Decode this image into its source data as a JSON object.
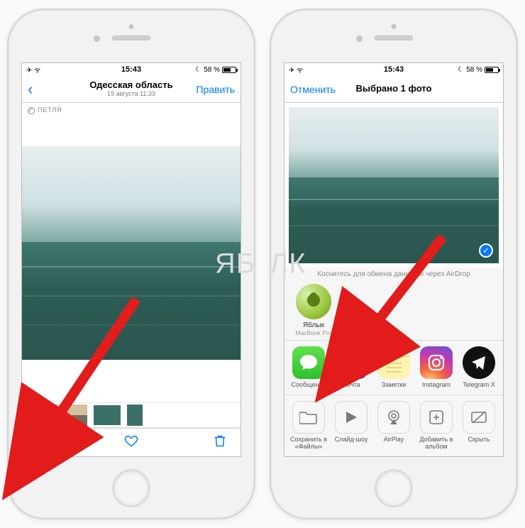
{
  "status": {
    "time": "15:43",
    "battery_pct": "58 %"
  },
  "left": {
    "nav_title": "Одесская область",
    "nav_subtitle": "19 августа  11:33",
    "edit_label": "Править",
    "loop_label": "ПЕТЛЯ"
  },
  "right": {
    "cancel_label": "Отменить",
    "nav_title": "Выбрано 1 фото",
    "airdrop_hint": "Коснитесь для обмена данными через AirDrop",
    "airdrop_item": {
      "name": "Яблык",
      "device": "MacBook Pro"
    },
    "apps": [
      {
        "label": "Сообщение",
        "name": "messages"
      },
      {
        "label": "Почта",
        "name": "mail"
      },
      {
        "label": "Заметки",
        "name": "notes"
      },
      {
        "label": "Instagram",
        "name": "instagram"
      },
      {
        "label": "Telegram X",
        "name": "telegram"
      }
    ],
    "actions": [
      {
        "label": "Сохранить в «Файлы»",
        "name": "save-files"
      },
      {
        "label": "Слайд-шоу",
        "name": "slideshow"
      },
      {
        "label": "AirPlay",
        "name": "airplay"
      },
      {
        "label": "Добавить в альбом",
        "name": "add-album"
      },
      {
        "label": "Скрыть",
        "name": "hide"
      }
    ]
  }
}
